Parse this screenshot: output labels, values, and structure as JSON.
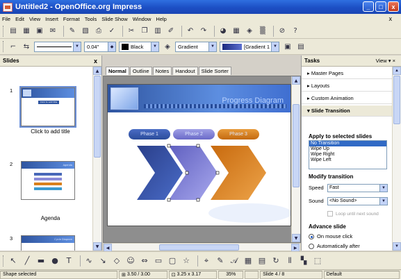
{
  "window": {
    "title": "Untitled2 - OpenOffice.org Impress",
    "minimize": "_",
    "maximize": "□",
    "close": "x"
  },
  "menu": [
    "File",
    "Edit",
    "View",
    "Insert",
    "Format",
    "Tools",
    "Slide Show",
    "Window",
    "Help"
  ],
  "doc_close": "x",
  "toolbar2": {
    "line_width": "0.04\"",
    "line_color": "Black",
    "area_style": "Gradient",
    "gradient_name": "[Gradient 1",
    "line_color_hex": "#000000",
    "gradient_hex": "#3a4ca0"
  },
  "slides_panel": {
    "title": "Slides",
    "close": "x",
    "slides": [
      {
        "num": "1",
        "label": "Click to add title",
        "band_title": "Click to add title"
      },
      {
        "num": "2",
        "label": "Agenda",
        "band_title": "Agenda"
      },
      {
        "num": "3",
        "label": "",
        "band_title": "Cycle Diagram"
      }
    ]
  },
  "view_tabs": [
    "Normal",
    "Outline",
    "Notes",
    "Handout",
    "Slide Sorter"
  ],
  "slide": {
    "title": "Progress Diagram",
    "phases": [
      "Phase 1",
      "Phase 2",
      "Phase 3"
    ],
    "colors": {
      "band": "#2f55a0",
      "arrow1": "#2b4c9b",
      "arrow2": "#8a8ad8",
      "arrow3": "#d9801c"
    }
  },
  "tasks": {
    "title": "Tasks",
    "view_label": "View",
    "sections": [
      "Master Pages",
      "Layouts",
      "Custom Animation",
      "Slide Transition"
    ],
    "apply_heading": "Apply to selected slides",
    "transitions": [
      "No Transition",
      "Wipe Up",
      "Wipe Right",
      "Wipe Left"
    ],
    "selected_transition": "No Transition",
    "modify_heading": "Modify transition",
    "speed_label": "Speed",
    "speed_value": "Fast",
    "sound_label": "Sound",
    "sound_value": "<No Sound>",
    "loop_label": "Loop until next sound",
    "advance_heading": "Advance slide",
    "on_click": "On mouse click",
    "auto_after": "Automatically after"
  },
  "status": {
    "action": "Shape selected",
    "position": "3.50 / 3.00",
    "size": "3.25 x 3.17",
    "zoom": "35%",
    "slide": "Slide 4 / 8",
    "layout": "Default"
  }
}
